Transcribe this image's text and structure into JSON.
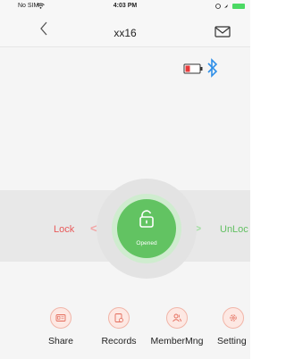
{
  "status_bar": {
    "carrier": "No SIM",
    "time": "4:03 PM"
  },
  "nav": {
    "title": "xx16"
  },
  "lock_control": {
    "lock_label": "Lock",
    "unlock_label": "UnLoc",
    "state": "Opened",
    "left_arrows": "<<",
    "right_arrows": ">>"
  },
  "actions": [
    {
      "label": "Share",
      "icon": "id-card-icon"
    },
    {
      "label": "Records",
      "icon": "records-icon"
    },
    {
      "label": "MemberMng",
      "icon": "members-icon"
    },
    {
      "label": "Setting",
      "icon": "gear-icon"
    }
  ],
  "colors": {
    "accent_green": "#62c362",
    "lock_red": "#e85a5a",
    "bluetooth_blue": "#2f8fe8",
    "battery_red": "#e83a3a"
  }
}
